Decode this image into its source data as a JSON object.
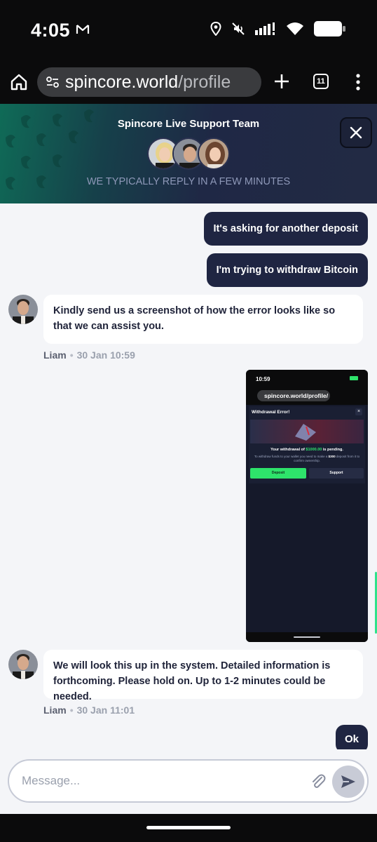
{
  "status_bar": {
    "time": "4:05",
    "icons": [
      "gmail-icon",
      "location-icon",
      "mute-icon",
      "signal-icon",
      "wifi-icon",
      "battery-icon"
    ]
  },
  "browser": {
    "url_host": "spincore.world",
    "url_path": "/profile",
    "tab_count": "11",
    "icons": [
      "home-icon",
      "site-settings-icon",
      "new-tab-icon",
      "tabs-icon",
      "more-menu-icon"
    ]
  },
  "support_header": {
    "title": "Spincore Live Support Team",
    "subtitle": "WE TYPICALLY REPLY IN A FEW MINUTES",
    "avatars": [
      "agent-1",
      "agent-2",
      "agent-3"
    ],
    "close_icon": "close-icon"
  },
  "messages": {
    "out_1": "It's asking for another deposit",
    "out_2": "I'm trying to withdraw Bitcoin",
    "in_1": {
      "text": "Kindly send us a screenshot of how the error looks like so that we can assist you.",
      "author": "Liam",
      "time": "30 Jan 10:59"
    },
    "attachment": {
      "time": "10:59",
      "url": "spincore.world/profile/",
      "window_title": "Withdrawal Error!",
      "pending_prefix": "Your withdrawal of",
      "pending_amount": "$1000.00",
      "pending_suffix": "is pending.",
      "note_prefix": "To withdraw funds to your wallet you need to make a",
      "note_amount": "$300",
      "note_suffix": "deposit from it to confirm ownership.",
      "deposit_label": "Deposit",
      "support_label": "Support"
    },
    "in_2": {
      "text": "We will look this up in the system. Detailed information is forthcoming. Please hold on. Up to 1-2 minutes could be needed.",
      "author": "Liam",
      "time": "30 Jan 11:01"
    },
    "out_3": "Ok"
  },
  "composer": {
    "placeholder": "Message...",
    "attach_icon": "paperclip-icon",
    "send_icon": "send-icon"
  },
  "colors": {
    "bubble_out": "#1f2542",
    "accent_green": "#2ee36b",
    "header_dark": "#222a44"
  }
}
